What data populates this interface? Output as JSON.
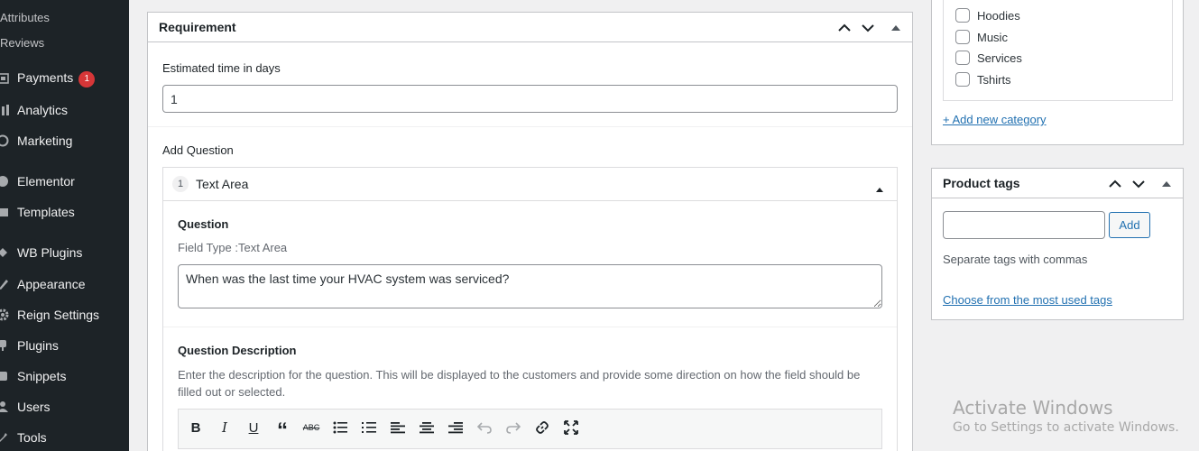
{
  "sidebar": {
    "subitems": [
      "Attributes",
      "Reviews"
    ],
    "items": [
      {
        "label": "Payments",
        "icon": "payments-icon",
        "badge": "1"
      },
      {
        "label": "Analytics",
        "icon": "bar-chart-icon"
      },
      {
        "label": "Marketing",
        "icon": "megaphone-icon"
      },
      {
        "label": "Elementor",
        "icon": "elementor-icon"
      },
      {
        "label": "Templates",
        "icon": "folder-icon"
      },
      {
        "label": "WB Plugins",
        "icon": "plugin-icon"
      },
      {
        "label": "Appearance",
        "icon": "brush-icon"
      },
      {
        "label": "Reign Settings",
        "icon": "gear-icon"
      },
      {
        "label": "Plugins",
        "icon": "plug-icon"
      },
      {
        "label": "Snippets",
        "icon": "scissors-icon"
      },
      {
        "label": "Users",
        "icon": "users-icon"
      },
      {
        "label": "Tools",
        "icon": "wrench-icon"
      }
    ]
  },
  "requirement": {
    "title": "Requirement",
    "estimated_label": "Estimated time in days",
    "estimated_value": "1",
    "add_question_label": "Add Question",
    "question_item": {
      "number": "1",
      "title": "Text Area"
    },
    "question_label": "Question",
    "field_type": "Field Type :Text Area",
    "question_value": "When was the last time your HVAC system was serviced?",
    "description_label": "Question Description",
    "description_help": "Enter the description for the question. This will be displayed to the customers and provide some direction on how the field should be filled out or selected.",
    "toolbar": [
      "B",
      "I",
      "U",
      "“",
      "ABC"
    ]
  },
  "categories": {
    "items": [
      "Hoodies",
      "Music",
      "Services",
      "Tshirts"
    ],
    "add_new": "+ Add new category"
  },
  "tags": {
    "title": "Product tags",
    "add_button": "Add",
    "hint": "Separate tags with commas",
    "choose_link": "Choose from the most used tags"
  },
  "watermark": {
    "title": "Activate Windows",
    "subtitle": "Go to Settings to activate Windows."
  },
  "colors": {
    "sidebar_bg": "#1d2327",
    "accent": "#2271b1",
    "badge": "#d63638"
  }
}
